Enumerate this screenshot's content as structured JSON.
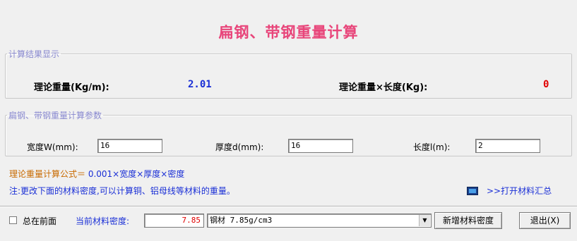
{
  "title": "扁钢、带钢重量计算",
  "result_group": {
    "legend": "计算结果显示",
    "weight_label": "理论重量(Kg/m):",
    "weight_value": "2.01",
    "total_label": "理论重量×长度(Kg):",
    "total_value": "0"
  },
  "param_group": {
    "legend": "扁钢、带钢重量计算参数",
    "width_label": "宽度W(mm):",
    "width_value": "16",
    "thickness_label": "厚度d(mm):",
    "thickness_value": "16",
    "length_label": "长度l(m):",
    "length_value": "2"
  },
  "formula": {
    "prefix": "理论重量计算公式＝",
    "expression": " 0.001×宽度×厚度×密度"
  },
  "note": "注:更改下面的材料密度,可以计算铜、铝母线等材料的重量。",
  "open_summary_label": ">>打开材料汇总",
  "bottom": {
    "always_on_top_label": "总在前面",
    "density_label": "当前材料密度:",
    "density_value": "7.85",
    "material_selected": "钢材 7.85g/cm3",
    "new_density_button": "新增材料密度",
    "exit_button": "退出(X)"
  },
  "colors": {
    "title": "#e8457a",
    "value_blue": "#1a2fd6",
    "value_red": "#e00000",
    "legend": "#8a8ad0",
    "formula_prefix": "#c86a00"
  }
}
